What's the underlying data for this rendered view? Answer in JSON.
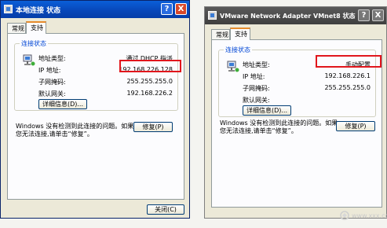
{
  "window_left": {
    "title": "本地连接 状态",
    "help_label": "?",
    "close_label": "X",
    "tabs": [
      "常规",
      "支持"
    ],
    "active_tab": "支持",
    "group_title": "连接状态",
    "rows": [
      {
        "label": "地址类型:",
        "value": "通过 DHCP 指派"
      },
      {
        "label": "IP 地址:",
        "value": "192.168.226.128"
      },
      {
        "label": "子网掩码:",
        "value": "255.255.255.0"
      },
      {
        "label": "默认网关:",
        "value": "192.168.226.2"
      }
    ],
    "details_button": "详细信息(D)...",
    "message_line1": "Windows 没有检测到此连接的问题。如果",
    "message_line2": "您无法连接,请单击“修复”。",
    "repair_button": "修复(P)",
    "close_button": "关闭(C)"
  },
  "window_right": {
    "title": "VMware Network Adapter VMnet8 状态",
    "help_label": "?",
    "close_label": "X",
    "tabs": [
      "常规",
      "支持"
    ],
    "active_tab": "支持",
    "group_title": "连接状态",
    "rows": [
      {
        "label": "地址类型:",
        "value": "手动配置"
      },
      {
        "label": "IP 地址:",
        "value": "192.168.226.1"
      },
      {
        "label": "子网掩码:",
        "value": "255.255.255.0"
      },
      {
        "label": "默认网关:",
        "value": ""
      }
    ],
    "details_button": "详细信息(D)...",
    "message_line1": "Windows 没有检测到此连接的问题。如果",
    "message_line2": "您无法连接,请单击“修复”。",
    "repair_button": "修复(P)"
  },
  "highlight_color": "#e1161c",
  "watermark": "www.xxx.com"
}
